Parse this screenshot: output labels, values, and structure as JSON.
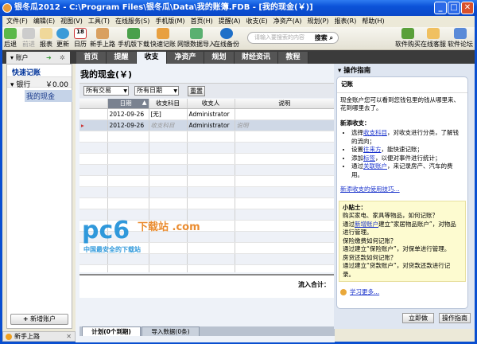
{
  "window": {
    "title": "银冬瓜2012 - C:\\Program Files\\银冬瓜\\Data\\我的账簿.FDB - [我的现金(￥)]"
  },
  "menu": [
    "文件(F)",
    "编辑(E)",
    "视图(V)",
    "工具(T)",
    "在线服务(S)",
    "手机版(M)",
    "首页(H)",
    "提醒(A)",
    "收支(E)",
    "净资产(A)",
    "规划(P)",
    "报表(R)",
    "帮助(H)"
  ],
  "toolbar": {
    "back": "后退",
    "forward": "前进",
    "report": "报表",
    "update": "更新",
    "calendar": "日历",
    "calendar_day": "18",
    "newbie": "新手上路",
    "mobile_download": "手机版下载",
    "quick_entry": "快速记账",
    "online_import": "网银数据导入",
    "online_backup": "在线备份",
    "search_placeholder": "请输入要搜索的内容",
    "search_button": "搜索",
    "buy": "软件购买",
    "support": "在线客服",
    "forum": "软件论坛"
  },
  "tabs": [
    "首页",
    "提醒",
    "收支",
    "净资产",
    "规划",
    "财经资讯",
    "教程"
  ],
  "sidebar": {
    "header": "账户",
    "quick_entry": "快速记账",
    "group": "银行",
    "group_amount": "￥0.00",
    "account": "我的现金",
    "add_account": "新增账户"
  },
  "main": {
    "title": "我的现金(￥)",
    "filter_type": "所有交易",
    "filter_date": "所有日期",
    "reset": "重置",
    "columns": [
      "日期",
      "收支科目",
      "收支人",
      "说明"
    ],
    "rows": [
      {
        "date": "2012-09-26",
        "category": "[无]",
        "payee": "Administrator",
        "note": ""
      },
      {
        "date": "2012-09-26",
        "category": "收支科目",
        "payee": "Administrator",
        "note": "说明"
      }
    ],
    "totals_label": "流入合计：",
    "bottom_tabs": [
      "计划(0个到期)",
      "导入数据(0条)"
    ]
  },
  "guide": {
    "header": "操作指南",
    "title": "记账",
    "intro": "现金账户您可以看到您钱包里的钱从哪里来、花到哪里去了。",
    "section": "新添收支：",
    "bullets": [
      {
        "pre": "选择",
        "link": "收支科目",
        "post": "，对收支进行分类，了解钱的流向；"
      },
      {
        "pre": "设置",
        "link": "往来方",
        "post": "，能快速记账；"
      },
      {
        "pre": "添加",
        "link": "标签",
        "post": "，以便对事件进行统计；"
      },
      {
        "pre": "通过",
        "link": "关联账户",
        "post": "，来记录房产、汽车的费用。"
      }
    ],
    "tips_link": "新添收支的使用技巧...",
    "tips_title": "小贴士：",
    "tip1": "购买家电、家具等物品，如何记账？",
    "tip1_pre": "通过",
    "tip1_link": "新增账户",
    "tip1_post": "建立“家居物品账户”，对物品进行管理。",
    "tip2": "保险缴费如何记账？",
    "tip2_ans": "通过建立“保险账户”，对保单进行管理。",
    "tip3": "房贷还款如何记账？",
    "tip3_ans": "通过建立“贷款账户”，对贷款还款进行记录。",
    "learn_more": "学习更多...",
    "do_now": "立即做",
    "guide_button": "操作指南"
  },
  "statusbar": {
    "newbie": "新手上路"
  },
  "watermark": {
    "logo": "pc6",
    "sub": "下载站 .com",
    "tagline": "中国最安全的下载站"
  }
}
